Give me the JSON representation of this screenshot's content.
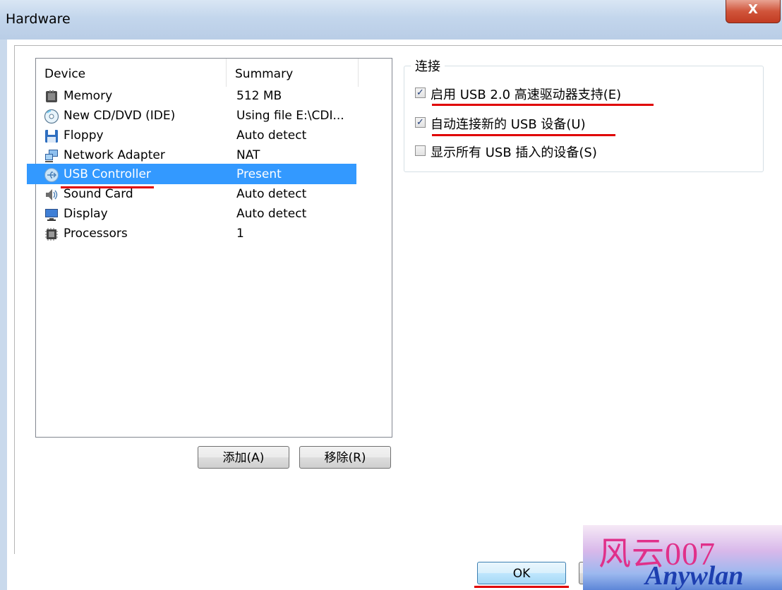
{
  "window": {
    "title": "Hardware",
    "close_glyph": "X"
  },
  "device_list": {
    "columns": [
      "Device",
      "Summary"
    ],
    "rows": [
      {
        "name": "Memory",
        "summary": "512 MB",
        "icon": "memory-icon"
      },
      {
        "name": "New CD/DVD (IDE)",
        "summary": "Using file E:\\CDI...",
        "icon": "cd-dvd-icon"
      },
      {
        "name": "Floppy",
        "summary": "Auto detect",
        "icon": "floppy-icon"
      },
      {
        "name": "Network Adapter",
        "summary": "NAT",
        "icon": "network-adapter-icon"
      },
      {
        "name": "USB Controller",
        "summary": "Present",
        "icon": "usb-icon",
        "selected": true
      },
      {
        "name": "Sound Card",
        "summary": "Auto detect",
        "icon": "speaker-icon"
      },
      {
        "name": "Display",
        "summary": "Auto detect",
        "icon": "monitor-icon"
      },
      {
        "name": "Processors",
        "summary": "1",
        "icon": "processor-icon"
      }
    ],
    "selection_color": "#3399ff"
  },
  "buttons": {
    "add": "添加(A)",
    "remove": "移除(R)",
    "ok": "OK"
  },
  "connection": {
    "title": "连接",
    "options": [
      {
        "label": "启用 USB 2.0 高速驱动器支持(E)",
        "checked": true
      },
      {
        "label": "自动连接新的 USB 设备(U)",
        "checked": true
      },
      {
        "label": "显示所有 USB 插入的设备(S)",
        "checked": false
      }
    ]
  },
  "watermark": {
    "cn": "风云007",
    "en": "Anywlan"
  },
  "annotation_color": "#e00000"
}
